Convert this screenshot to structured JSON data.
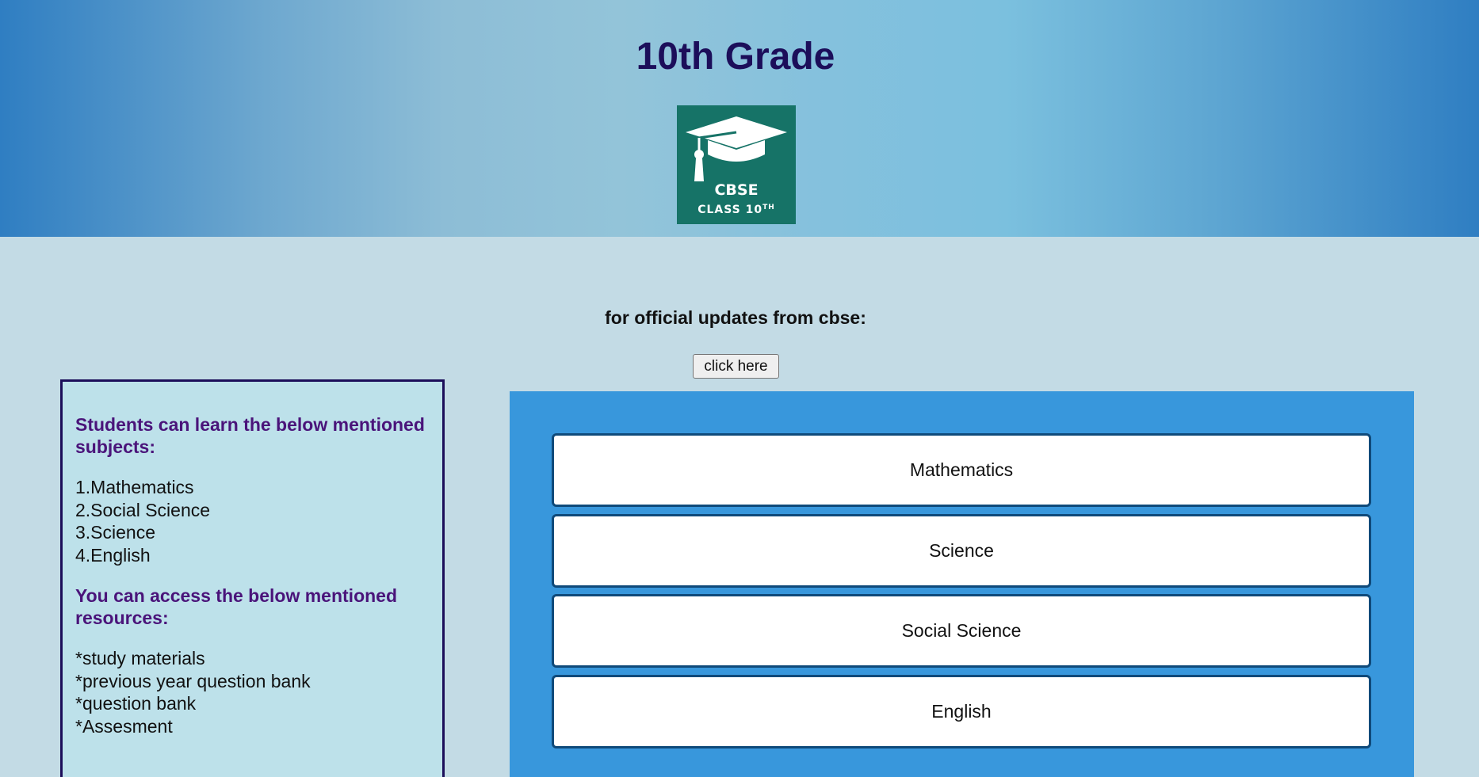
{
  "header": {
    "title": "10th Grade",
    "logo": {
      "icon": "graduation-cap-icon",
      "line1": "CBSE",
      "line2": "CLASS 10",
      "line2_sup": "TH",
      "bg_color": "#167367"
    }
  },
  "updates": {
    "label": "for official updates from cbse:",
    "button_label": "click here"
  },
  "info": {
    "subjects_heading": "Students can learn the below mentioned subjects:",
    "subjects": [
      "1.Mathematics",
      "2.Social Science",
      "3.Science",
      "4.English"
    ],
    "resources_heading": "You can access the below mentioned resources:",
    "resources": [
      "*study materials",
      "*previous year question bank",
      "*question bank",
      "*Assesment"
    ]
  },
  "subject_buttons": [
    "Mathematics",
    "Science",
    "Social Science",
    "English"
  ],
  "colors": {
    "title": "#1c0e5a",
    "heading": "#4a147a",
    "panel": "#3897dc",
    "page_bg": "#c3dbe5"
  }
}
